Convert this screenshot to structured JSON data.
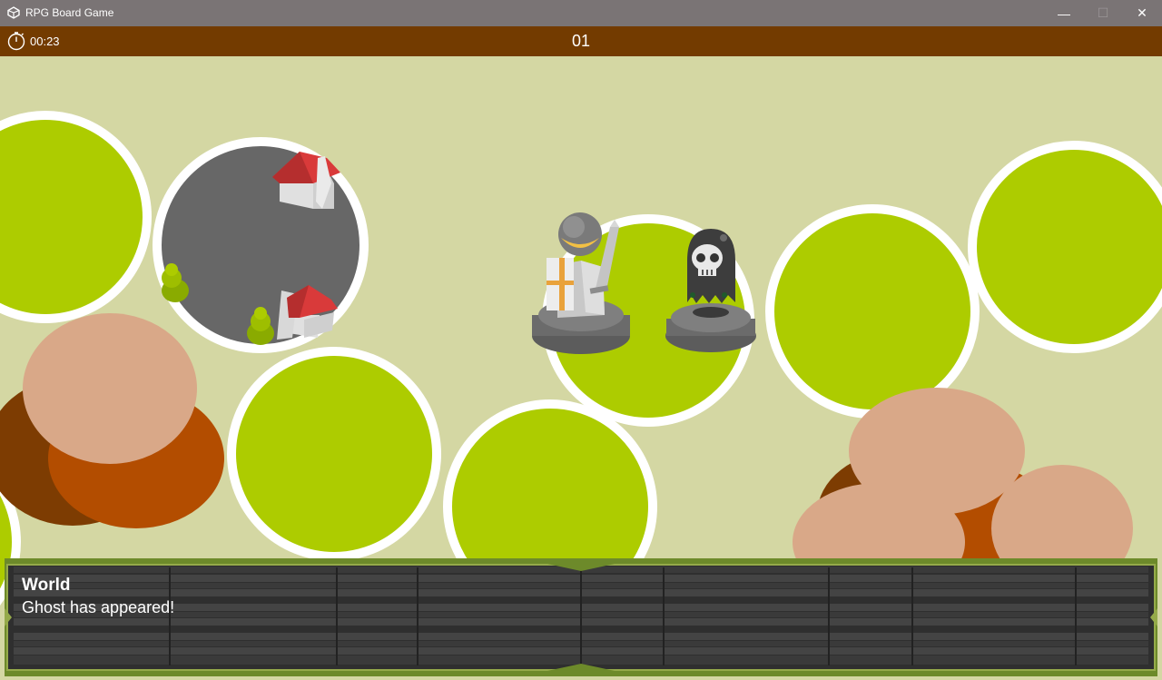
{
  "window": {
    "title": "RPG Board Game",
    "minimize_glyph": "—",
    "maximize_glyph": "☐",
    "close_glyph": "✕",
    "icon": "unity-icon"
  },
  "hud": {
    "timer": "00:23",
    "timer_icon": "stopwatch-icon",
    "turn": "01"
  },
  "dialog": {
    "speaker": "World",
    "message": "Ghost has appeared!"
  },
  "colors": {
    "board_bg": "#d4d7a3",
    "tile_green": "#adcc00",
    "tile_rock": "#676767",
    "hud_bar": "#733b00",
    "house_roof": "#d93a3a",
    "hill_light": "#d9a888",
    "hill_dark": "#b34d00"
  }
}
